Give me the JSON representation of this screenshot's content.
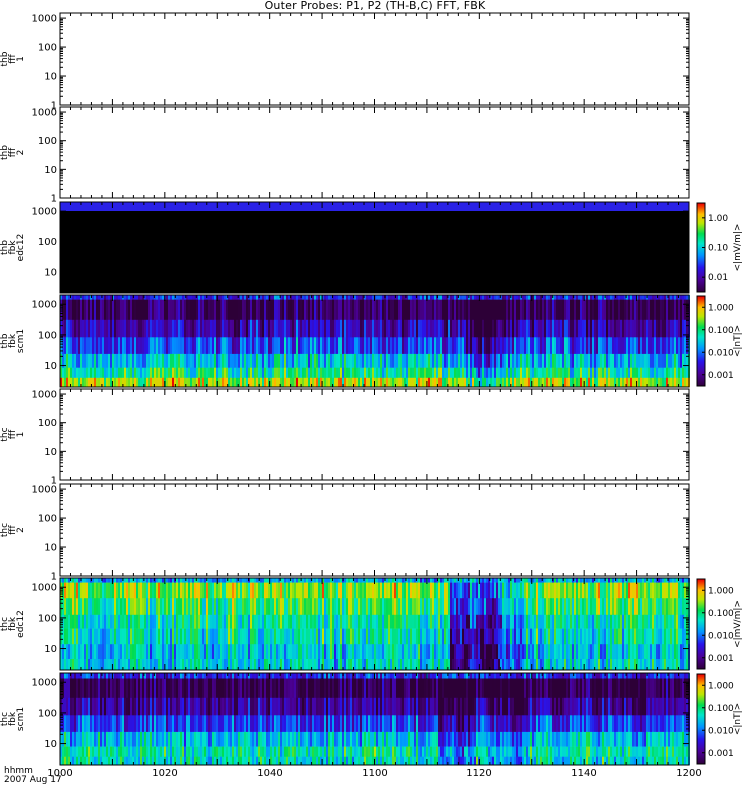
{
  "title": "Outer Probes: P1, P2 (TH-B,C) FFT, FBK",
  "x_axis": {
    "caption_line1": "hhmm",
    "caption_line2": "2007 Aug 17",
    "ticks": [
      "1000",
      "1020",
      "1040",
      "1100",
      "1120",
      "1140",
      "1200"
    ]
  },
  "chart_data": [
    {
      "type": "heatmap",
      "id": "thb_fff_1",
      "ylabel": [
        "thb",
        "fff",
        "1"
      ],
      "yscale": "log",
      "yticks": [
        "1",
        "10",
        "100",
        "1000"
      ],
      "ylim": [
        1,
        1500
      ],
      "status": "no data",
      "colorbar": null
    },
    {
      "type": "heatmap",
      "id": "thb_fff_2",
      "ylabel": [
        "thb",
        "fff",
        "2"
      ],
      "yscale": "log",
      "yticks": [
        "1",
        "10",
        "100",
        "1000"
      ],
      "ylim": [
        1,
        1500
      ],
      "status": "no data",
      "colorbar": null
    },
    {
      "type": "heatmap",
      "id": "thb_fbk_edc12",
      "ylabel": [
        "thb",
        "fbk",
        "edc12"
      ],
      "yscale": "log",
      "yticks": [
        "10",
        "100",
        "1000"
      ],
      "ylim": [
        2,
        2000
      ],
      "status": "uniform",
      "colorbar": {
        "label": "<|mV/m|>",
        "ticks": [
          "0.01",
          "0.10",
          "1.00"
        ]
      }
    },
    {
      "type": "heatmap",
      "id": "thb_fbk_scm1",
      "ylabel": [
        "thb",
        "fbk",
        "scm1"
      ],
      "yscale": "log",
      "yticks": [
        "10",
        "100",
        "1000"
      ],
      "ylim": [
        2,
        2000
      ],
      "status": "spectrogram",
      "colorbar": {
        "label": "<|nT|>",
        "ticks": [
          "0.001",
          "0.010",
          "0.100",
          "1.000"
        ]
      }
    },
    {
      "type": "heatmap",
      "id": "thc_fff_1",
      "ylabel": [
        "thc",
        "fff",
        "1"
      ],
      "yscale": "log",
      "yticks": [
        "1",
        "10",
        "100",
        "1000"
      ],
      "ylim": [
        1,
        1500
      ],
      "status": "no data",
      "colorbar": null
    },
    {
      "type": "heatmap",
      "id": "thc_fff_2",
      "ylabel": [
        "thc",
        "fff",
        "2"
      ],
      "yscale": "log",
      "yticks": [
        "1",
        "10",
        "100",
        "1000"
      ],
      "ylim": [
        1,
        1500
      ],
      "status": "no data",
      "colorbar": null
    },
    {
      "type": "heatmap",
      "id": "thc_fbk_edc12",
      "ylabel": [
        "thc",
        "fbk",
        "edc12"
      ],
      "yscale": "log",
      "yticks": [
        "10",
        "100",
        "1000"
      ],
      "ylim": [
        2,
        2000
      ],
      "status": "spectrogram",
      "colorbar": {
        "label": "<|mV/m|>",
        "ticks": [
          "0.001",
          "0.010",
          "0.100",
          "1.000"
        ]
      }
    },
    {
      "type": "heatmap",
      "id": "thc_fbk_scm1",
      "ylabel": [
        "thc",
        "fbk",
        "scm1"
      ],
      "yscale": "log",
      "yticks": [
        "10",
        "100",
        "1000"
      ],
      "ylim": [
        2,
        2000
      ],
      "status": "spectrogram",
      "colorbar": {
        "label": "<|nT|>",
        "ticks": [
          "0.001",
          "0.010",
          "0.100",
          "1.000"
        ]
      }
    }
  ]
}
